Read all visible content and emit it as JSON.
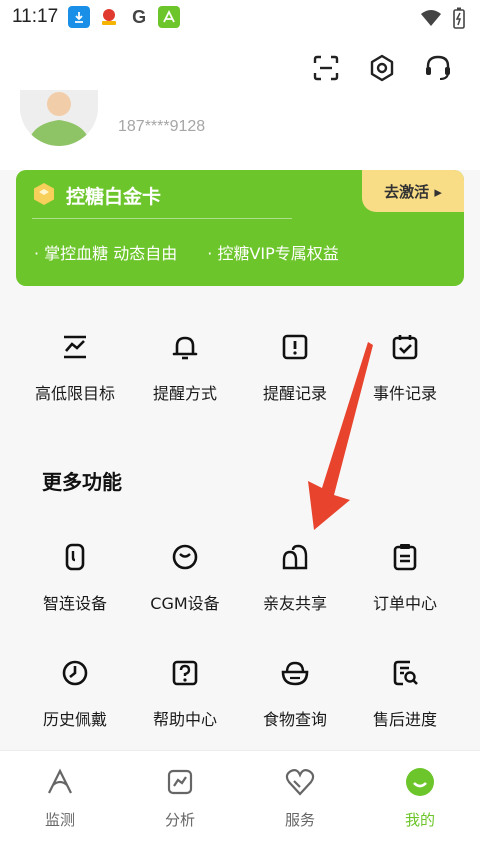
{
  "status_bar": {
    "time": "11:17",
    "notif_g": "G"
  },
  "header": {
    "phone": "187****9128"
  },
  "vip_card": {
    "title": "控糖白金卡",
    "activate_label": "去激活 ▸",
    "perk_1": "· 掌控血糖 动态自由",
    "perk_2": "· 控糖VIP专属权益"
  },
  "quick_actions": [
    {
      "label": "高低限目标",
      "icon": "threshold-icon"
    },
    {
      "label": "提醒方式",
      "icon": "bell-icon"
    },
    {
      "label": "提醒记录",
      "icon": "alert-icon"
    },
    {
      "label": "事件记录",
      "icon": "calendar-check-icon"
    }
  ],
  "more_section": {
    "title": "更多功能",
    "items": [
      {
        "label": "智连设备",
        "icon": "device-link-icon"
      },
      {
        "label": "CGM设备",
        "icon": "cgm-sensor-icon"
      },
      {
        "label": "亲友共享",
        "icon": "family-share-icon"
      },
      {
        "label": "订单中心",
        "icon": "order-clipboard-icon"
      },
      {
        "label": "历史佩戴",
        "icon": "history-clock-icon"
      },
      {
        "label": "帮助中心",
        "icon": "help-icon"
      },
      {
        "label": "食物查询",
        "icon": "food-bowl-icon"
      },
      {
        "label": "售后进度",
        "icon": "aftersales-search-icon"
      }
    ]
  },
  "tabbar": {
    "tabs": [
      {
        "label": "监测"
      },
      {
        "label": "分析"
      },
      {
        "label": "服务"
      },
      {
        "label": "我的"
      }
    ],
    "active_index": 3
  },
  "colors": {
    "brand_green": "#6cc52a",
    "gold": "#f8dc86",
    "arrow_red": "#e8432d"
  }
}
